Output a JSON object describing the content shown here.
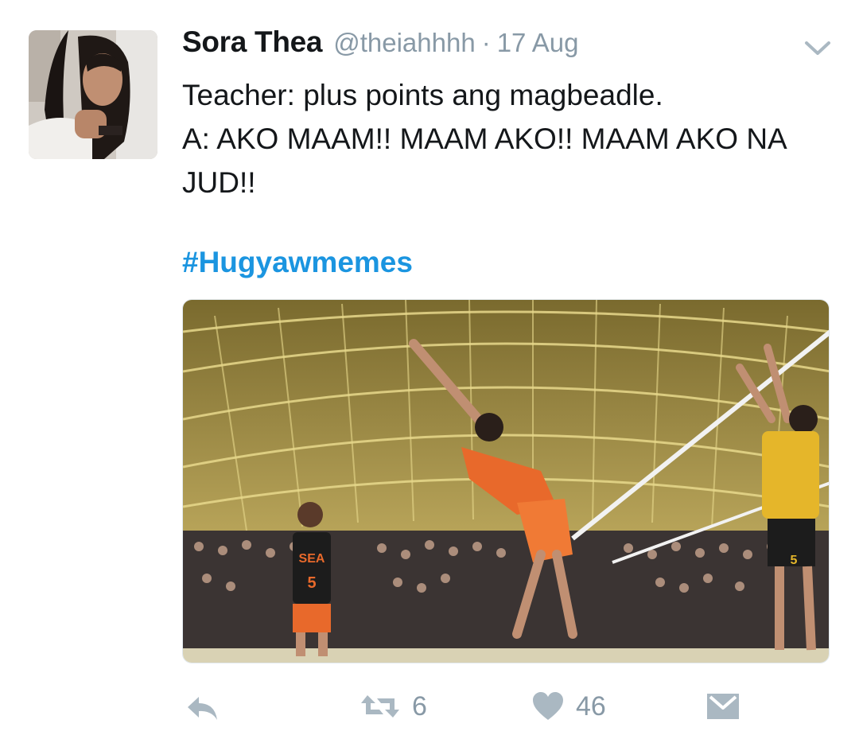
{
  "tweet": {
    "author_name": "Sora Thea",
    "handle": "@theiahhhh",
    "separator": "·",
    "date": "17 Aug",
    "text_lines": [
      "Teacher: plus points ang magbeadle.",
      "A: AKO MAAM!! MAAM AKO!! MAAM AKO NA JUD!!"
    ],
    "hashtag": "#Hugyawmemes",
    "media": {
      "jersey_left": "SEA",
      "jersey_number_left": "5",
      "jersey_number_right": "5"
    }
  },
  "actions": {
    "reply_icon": "reply-icon",
    "retweet_icon": "retweet-icon",
    "retweet_count": "6",
    "like_icon": "heart-icon",
    "like_count": "46",
    "dm_icon": "direct-message-icon"
  },
  "colors": {
    "text": "#14171a",
    "secondary": "#8899a6",
    "link": "#1b95e0"
  }
}
